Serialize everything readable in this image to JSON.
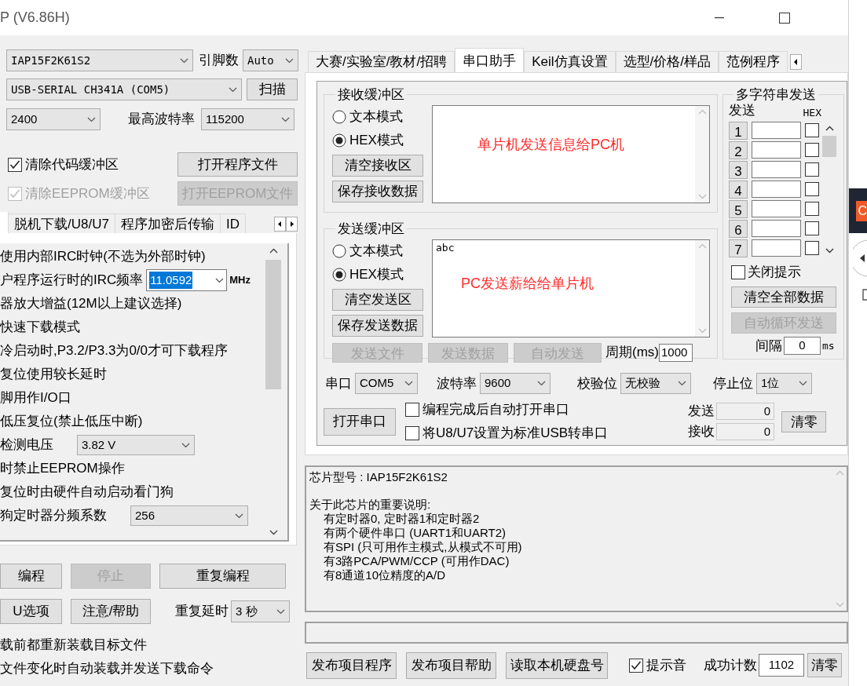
{
  "window": {
    "title": "P (V6.86H)"
  },
  "left": {
    "chip": "IAP15F2K61S2",
    "pins_label": "引脚数",
    "pins": "Auto",
    "port": "USB-SERIAL CH341A (COM5)",
    "scan_button": "扫描",
    "min_baud": "2400",
    "max_baud_label": "最高波特率",
    "max_baud": "115200",
    "buffer_options": [
      {
        "label": "清除代码缓冲区",
        "checked": true,
        "disabled": false,
        "button": "打开程序文件"
      },
      {
        "label": "清除EEPROM缓冲区",
        "checked": true,
        "disabled": true,
        "button": "打开EEPROM文件"
      }
    ],
    "tabs": [
      {
        "label": "脱机下载/U8/U7",
        "selected": false
      },
      {
        "label": "程序加密后传输",
        "selected": false
      },
      {
        "label": "ID",
        "selected": false
      }
    ],
    "hw_options": [
      {
        "kind": "text",
        "label": "使用内部IRC时钟(不选为外部时钟)"
      },
      {
        "kind": "freq",
        "label": "户程序运行时的IRC频率",
        "value": "11.0592",
        "unit": "MHz"
      },
      {
        "kind": "text",
        "label": "器放大增益(12M以上建议选择)"
      },
      {
        "kind": "text",
        "label": "快速下载模式"
      },
      {
        "kind": "text",
        "label": "冷启动时,P3.2/P3.3为0/0才可下载程序"
      },
      {
        "kind": "text",
        "label": "复位使用较长延时"
      },
      {
        "kind": "text",
        "label": "脚用作I/O口"
      },
      {
        "kind": "text",
        "label": "低压复位(禁止低压中断)"
      },
      {
        "kind": "select",
        "label": "检测电压",
        "value": "3.82 V"
      },
      {
        "kind": "text",
        "label": "时禁止EEPROM操作"
      },
      {
        "kind": "text",
        "label": "复位时由硬件自动启动看门狗"
      },
      {
        "kind": "select",
        "label": "狗定时器分频系数",
        "value": "256"
      }
    ],
    "actions": [
      {
        "label": "编程",
        "disabled": false
      },
      {
        "label": "停止",
        "disabled": true
      },
      {
        "label": "重复编程",
        "disabled": false
      }
    ],
    "actions2": [
      {
        "label": "U选项",
        "disabled": false
      },
      {
        "label": "注意/帮助",
        "disabled": false
      }
    ],
    "delay_label": "重复延时",
    "delay": "3 秒",
    "footer_lines": [
      "载前都重新装载目标文件",
      "文件变化时自动装载并发送下载命令"
    ]
  },
  "right": {
    "tabs": [
      {
        "label": "大赛/实验室/教材/招聘",
        "selected": false
      },
      {
        "label": "串口助手",
        "selected": true
      },
      {
        "label": "Keil仿真设置",
        "selected": false
      },
      {
        "label": "选型/价格/样品",
        "selected": false
      },
      {
        "label": "范例程序",
        "selected": false
      }
    ],
    "receive": {
      "title": "接收缓冲区",
      "modes": [
        {
          "label": "文本模式",
          "selected": false
        },
        {
          "label": "HEX模式",
          "selected": true
        }
      ],
      "buttons": [
        "清空接收区",
        "保存接收数据"
      ],
      "annotation": "单片机发送信息给PC机"
    },
    "send": {
      "title": "发送缓冲区",
      "modes": [
        {
          "label": "文本模式",
          "selected": false
        },
        {
          "label": "HEX模式",
          "selected": true
        }
      ],
      "buttons": [
        "清空发送区",
        "保存发送数据"
      ],
      "value": "abc",
      "annotation": "PC发送薪给给单片机",
      "actions": [
        {
          "label": "发送文件",
          "disabled": true
        },
        {
          "label": "发送数据",
          "disabled": true
        },
        {
          "label": "自动发送",
          "disabled": true
        }
      ],
      "period_label": "周期(ms)",
      "period": "1000"
    },
    "multi": {
      "title": "多字符串发送",
      "send_header": "发送",
      "hex_header": "HEX",
      "rows": [
        {
          "number": "1",
          "hex": false
        },
        {
          "number": "2",
          "hex": false
        },
        {
          "number": "3",
          "hex": false
        },
        {
          "number": "4",
          "hex": false
        },
        {
          "number": "5",
          "hex": false
        },
        {
          "number": "6",
          "hex": false
        },
        {
          "number": "7",
          "hex": false
        }
      ],
      "close_hint": {
        "label": "关闭提示",
        "checked": false
      },
      "buttons": [
        {
          "label": "清空全部数据",
          "disabled": false
        },
        {
          "label": "自动循环发送",
          "disabled": true
        }
      ],
      "interval_label": "间隔",
      "interval": "0",
      "unit": "ms"
    },
    "serial": {
      "fields": [
        {
          "label": "串口",
          "value": "COM5"
        },
        {
          "label": "波特率",
          "value": "9600"
        },
        {
          "label": "校验位",
          "value": "无校验"
        },
        {
          "label": "停止位",
          "value": "1位"
        }
      ],
      "open_button": "打开串口",
      "checks": [
        {
          "label": "编程完成后自动打开串口",
          "checked": false
        },
        {
          "label": "将U8/U7设置为标准USB转串口",
          "checked": false
        }
      ],
      "counters": [
        {
          "label": "发送",
          "value": "0"
        },
        {
          "label": "接收",
          "value": "0"
        }
      ],
      "clear_button": "清零"
    },
    "info": {
      "chip_line": "芯片型号 : IAP15F2K61S2",
      "notes_title": "关于此芯片的重要说明:",
      "notes": [
        "有定时器0, 定时器1和定时器2",
        "有两个硬件串口 (UART1和UART2)",
        "有SPI (只可用作主模式,从模式不可用)",
        "有3路PCA/PWM/CCP (可用作DAC)",
        "有8通道10位精度的A/D"
      ]
    },
    "bottom": {
      "buttons": [
        "发布项目程序",
        "发布项目帮助",
        "读取本机硬盘号"
      ],
      "beep": {
        "label": "提示音",
        "checked": true
      },
      "count_label": "成功计数",
      "count": "1102",
      "clear_button": "清零"
    }
  },
  "side": {
    "badge": "C"
  }
}
